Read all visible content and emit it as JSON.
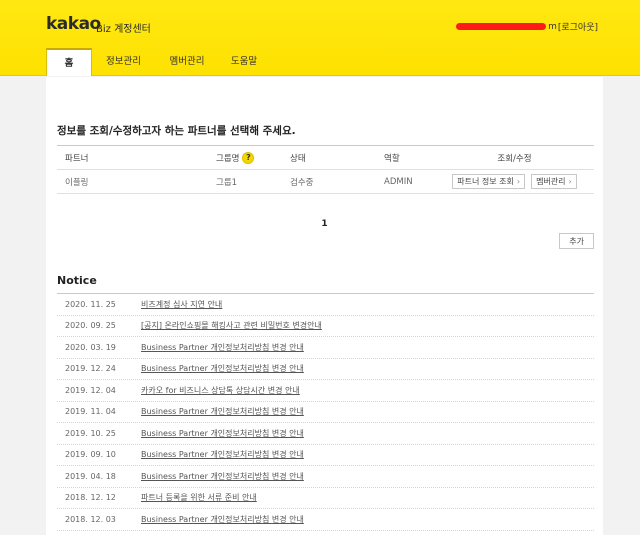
{
  "header": {
    "logo": "kakao",
    "logo_sub": "Biz 계정센터",
    "user_email_tail": "m",
    "logout_label": "로그아웃"
  },
  "nav": {
    "tabs": [
      {
        "label": "홈",
        "active": true
      },
      {
        "label": "정보관리",
        "active": false
      },
      {
        "label": "멤버관리",
        "active": false
      },
      {
        "label": "도움말",
        "active": false
      }
    ]
  },
  "main": {
    "section_title": "정보를 조회/수정하고자 하는 파트너를 선택해 주세요.",
    "partner_table": {
      "columns": [
        "파트너",
        "그룹명",
        "상태",
        "역할",
        "조회/수정"
      ],
      "rows": [
        {
          "partner": "이플링",
          "group": "그룹1",
          "status": "검수중",
          "role": "ADMIN",
          "btn_info": "파트너 정보 조회",
          "btn_member": "멤버관리"
        }
      ]
    },
    "help_icon": "?",
    "pager": "1",
    "add_button": "추가"
  },
  "notice": {
    "title": "Notice",
    "items": [
      {
        "date": "2020. 11. 25",
        "title": "비즈계정 심사 지연 안내"
      },
      {
        "date": "2020. 09. 25",
        "title": "[공지] 온라인쇼핑몰 해킹사고 관련 비밀번호 변경안내"
      },
      {
        "date": "2020. 03. 19",
        "title": "Business Partner 개인정보처리방침 변경 안내"
      },
      {
        "date": "2019. 12. 24",
        "title": "Business Partner 개인정보처리방침 변경 안내"
      },
      {
        "date": "2019. 12. 04",
        "title": "카카오 for 비즈니스 상담톡 상담시간 변경 안내"
      },
      {
        "date": "2019. 11. 04",
        "title": "Business Partner 개인정보처리방침 변경 안내"
      },
      {
        "date": "2019. 10. 25",
        "title": "Business Partner 개인정보처리방침 변경 안내"
      },
      {
        "date": "2019. 09. 10",
        "title": "Business Partner 개인정보처리방침 변경 안내"
      },
      {
        "date": "2019. 04. 18",
        "title": "Business Partner 개인정보처리방침 변경 안내"
      },
      {
        "date": "2018. 12. 12",
        "title": "파트너 등록을 위한 서류 준비 안내"
      },
      {
        "date": "2018. 12. 03",
        "title": "Business Partner 개인정보처리방침 변경 안내"
      }
    ]
  }
}
